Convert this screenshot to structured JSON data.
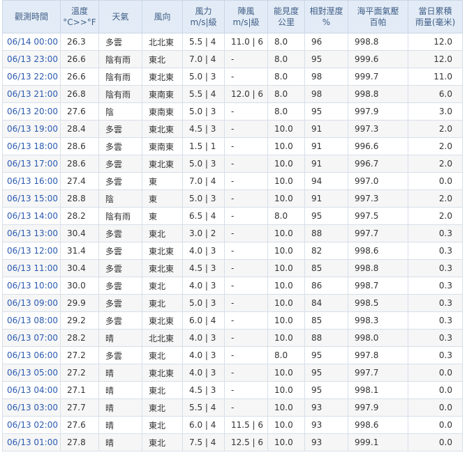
{
  "headers": [
    {
      "l1": "觀測時間",
      "l2": ""
    },
    {
      "l1": "溫度",
      "l2": "°C>>°F"
    },
    {
      "l1": "天氣",
      "l2": ""
    },
    {
      "l1": "風向",
      "l2": ""
    },
    {
      "l1": "風力",
      "l2": "m/s|級"
    },
    {
      "l1": "陣風",
      "l2": "m/s|級"
    },
    {
      "l1": "能見度",
      "l2": "公里"
    },
    {
      "l1": "相對溼度",
      "l2": "%"
    },
    {
      "l1": "海平面氣壓",
      "l2": "百帕"
    },
    {
      "l1": "當日累積",
      "l2": "雨量(毫米)"
    }
  ],
  "rows": [
    [
      "06/14 00:00",
      "26.3",
      "多雲",
      "北北東",
      "5.5 | 4",
      "11.0 | 6",
      "8.0",
      "96",
      "998.8",
      "12.0"
    ],
    [
      "06/13 23:00",
      "26.6",
      "陰有雨",
      "東北",
      "7.0 | 4",
      "-",
      "8.0",
      "95",
      "999.6",
      "12.0"
    ],
    [
      "06/13 22:00",
      "26.6",
      "陰有雨",
      "東北東",
      "5.0 | 3",
      "-",
      "8.0",
      "98",
      "999.7",
      "11.0"
    ],
    [
      "06/13 21:00",
      "26.8",
      "陰有雨",
      "東南東",
      "5.5 | 4",
      "12.0 | 6",
      "8.0",
      "98",
      "998.8",
      "6.0"
    ],
    [
      "06/13 20:00",
      "27.6",
      "陰",
      "東南東",
      "5.0 | 3",
      "-",
      "8.0",
      "95",
      "997.9",
      "3.0"
    ],
    [
      "06/13 19:00",
      "28.4",
      "多雲",
      "東北東",
      "4.5 | 3",
      "-",
      "10.0",
      "91",
      "997.3",
      "2.0"
    ],
    [
      "06/13 18:00",
      "28.6",
      "多雲",
      "東南東",
      "1.5 | 1",
      "-",
      "10.0",
      "91",
      "996.6",
      "2.0"
    ],
    [
      "06/13 17:00",
      "28.6",
      "多雲",
      "東北東",
      "5.0 | 3",
      "-",
      "10.0",
      "91",
      "996.7",
      "2.0"
    ],
    [
      "06/13 16:00",
      "27.4",
      "多雲",
      "東",
      "7.0 | 4",
      "-",
      "10.0",
      "94",
      "997.0",
      "0.0"
    ],
    [
      "06/13 15:00",
      "28.8",
      "陰",
      "東",
      "5.0 | 3",
      "-",
      "10.0",
      "91",
      "997.3",
      "2.0"
    ],
    [
      "06/13 14:00",
      "28.2",
      "陰有雨",
      "東",
      "6.5 | 4",
      "-",
      "8.0",
      "95",
      "997.5",
      "2.0"
    ],
    [
      "06/13 13:00",
      "30.4",
      "多雲",
      "東北",
      "3.0 | 2",
      "-",
      "10.0",
      "88",
      "997.7",
      "0.3"
    ],
    [
      "06/13 12:00",
      "31.4",
      "多雲",
      "東北東",
      "4.0 | 3",
      "-",
      "10.0",
      "82",
      "998.6",
      "0.3"
    ],
    [
      "06/13 11:00",
      "30.4",
      "多雲",
      "東北東",
      "4.5 | 3",
      "-",
      "10.0",
      "85",
      "998.8",
      "0.3"
    ],
    [
      "06/13 10:00",
      "30.0",
      "多雲",
      "東北",
      "4.0 | 3",
      "-",
      "10.0",
      "86",
      "998.7",
      "0.3"
    ],
    [
      "06/13 09:00",
      "29.9",
      "多雲",
      "東北",
      "5.0 | 3",
      "-",
      "10.0",
      "84",
      "998.5",
      "0.3"
    ],
    [
      "06/13 08:00",
      "29.2",
      "多雲",
      "東北東",
      "6.0 | 4",
      "-",
      "10.0",
      "85",
      "998.3",
      "0.3"
    ],
    [
      "06/13 07:00",
      "28.2",
      "晴",
      "北北東",
      "4.0 | 3",
      "-",
      "10.0",
      "88",
      "998.0",
      "0.3"
    ],
    [
      "06/13 06:00",
      "27.2",
      "多雲",
      "東北",
      "4.0 | 3",
      "-",
      "8.0",
      "95",
      "997.8",
      "0.3"
    ],
    [
      "06/13 05:00",
      "27.2",
      "晴",
      "東北東",
      "4.0 | 3",
      "-",
      "10.0",
      "95",
      "997.7",
      "0.0"
    ],
    [
      "06/13 04:00",
      "27.1",
      "晴",
      "東北",
      "4.5 | 3",
      "-",
      "10.0",
      "95",
      "998.1",
      "0.0"
    ],
    [
      "06/13 03:00",
      "27.7",
      "晴",
      "東北",
      "5.5 | 4",
      "-",
      "10.0",
      "93",
      "997.9",
      "0.0"
    ],
    [
      "06/13 02:00",
      "27.6",
      "晴",
      "東北",
      "6.0 | 4",
      "11.5 | 6",
      "10.0",
      "93",
      "998.6",
      "0.0"
    ],
    [
      "06/13 01:00",
      "27.8",
      "晴",
      "東北",
      "7.5 | 4",
      "12.5 | 6",
      "10.0",
      "93",
      "999.1",
      "0.0"
    ]
  ]
}
